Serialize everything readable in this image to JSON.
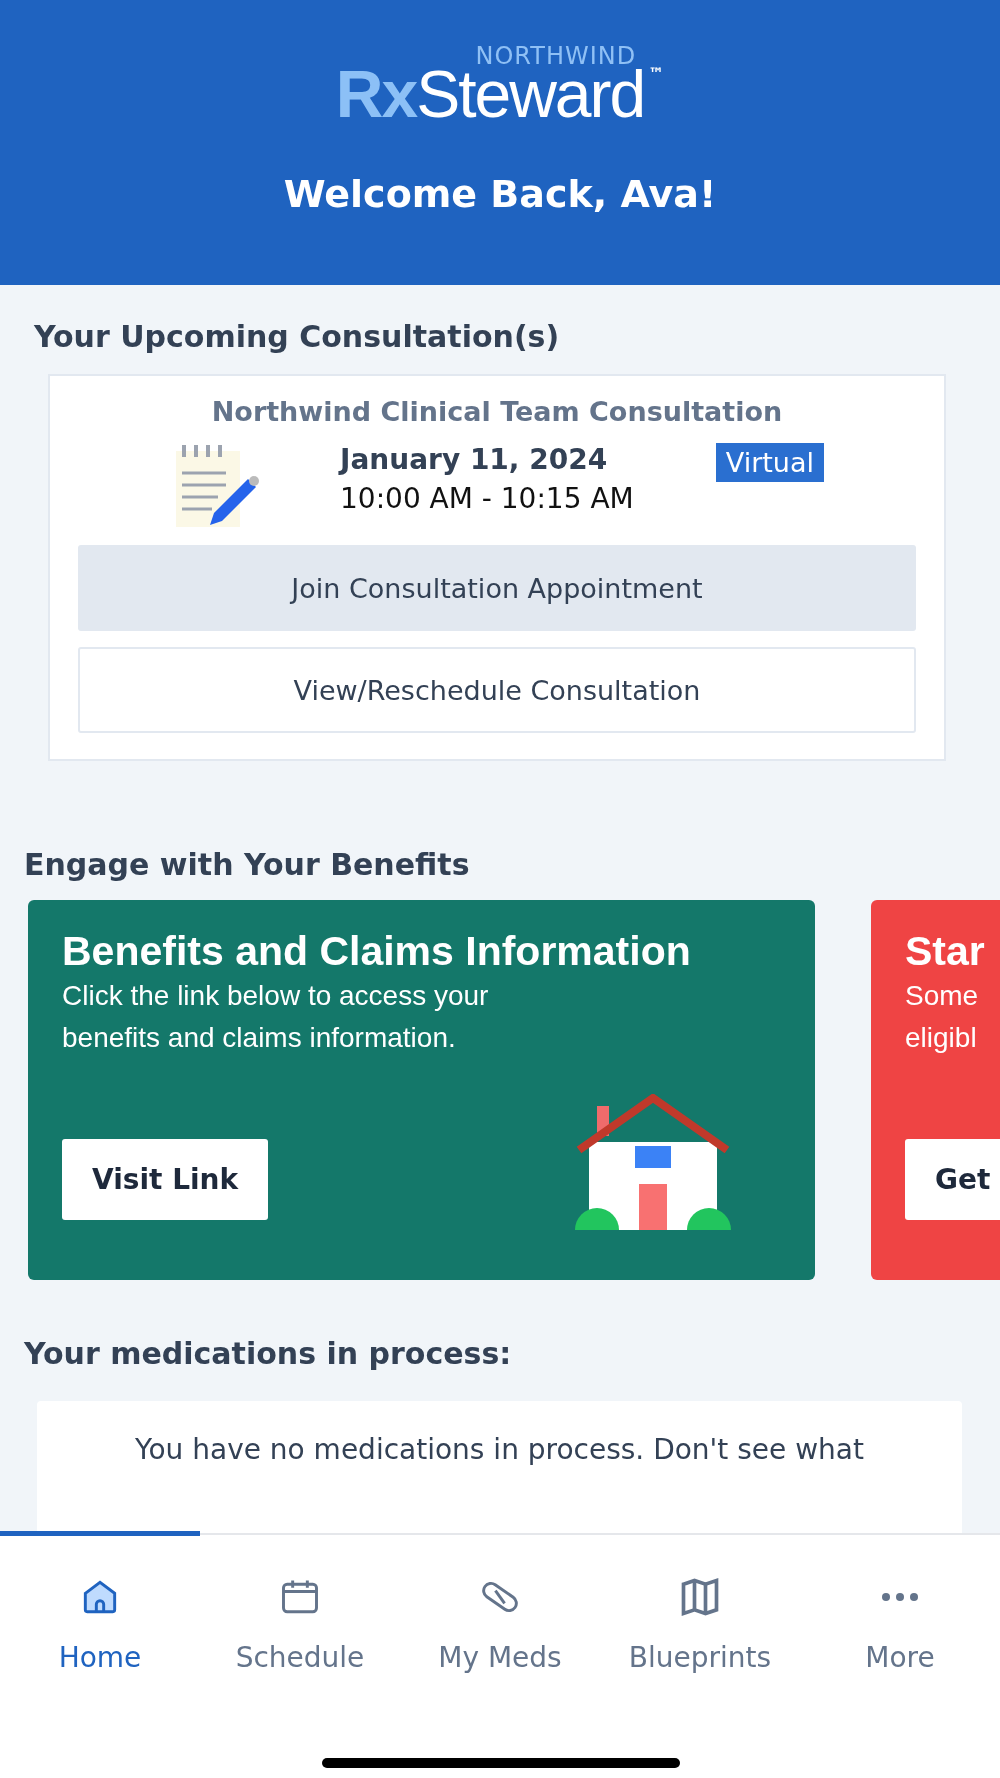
{
  "header": {
    "logo": {
      "brand_top": "NORTHWIND",
      "prefix": "Rx",
      "name": "Steward",
      "mark": "™"
    },
    "welcome": "Welcome Back, Ava!"
  },
  "consultations": {
    "title": "Your Upcoming Consultation(s)",
    "items": [
      {
        "title": "Northwind Clinical Team Consultation",
        "date": "January 11, 2024",
        "time": "10:00 AM - 10:15 AM",
        "badge": "Virtual",
        "buttons": [
          {
            "label": "Join Consultation Appointment",
            "kind": "filled"
          },
          {
            "label": "View/Reschedule Consultation",
            "kind": "outline"
          }
        ]
      }
    ]
  },
  "benefits": {
    "title": "Engage with Your Benefits",
    "cards": [
      {
        "title": "Benefits and Claims Information",
        "lines": [
          "Click the link below to access your",
          "benefits and claims information."
        ],
        "button": "Visit Link",
        "color": "#14786a",
        "kind": "house"
      },
      {
        "title": "Star",
        "lines": [
          "Some",
          "eligibl"
        ],
        "button": "Get",
        "color": "#ef4444",
        "kind": "none"
      }
    ]
  },
  "medications": {
    "title": "Your medications in process:",
    "message": "You have no medications in process. Don't see what"
  },
  "nav": [
    {
      "label": "Home",
      "kind": "home",
      "selected": true
    },
    {
      "label": "Schedule",
      "kind": "calendar",
      "selected": false
    },
    {
      "label": "My Meds",
      "kind": "pill",
      "selected": false
    },
    {
      "label": "Blueprints",
      "kind": "map",
      "selected": false
    },
    {
      "label": "More",
      "kind": "more",
      "selected": false
    }
  ]
}
